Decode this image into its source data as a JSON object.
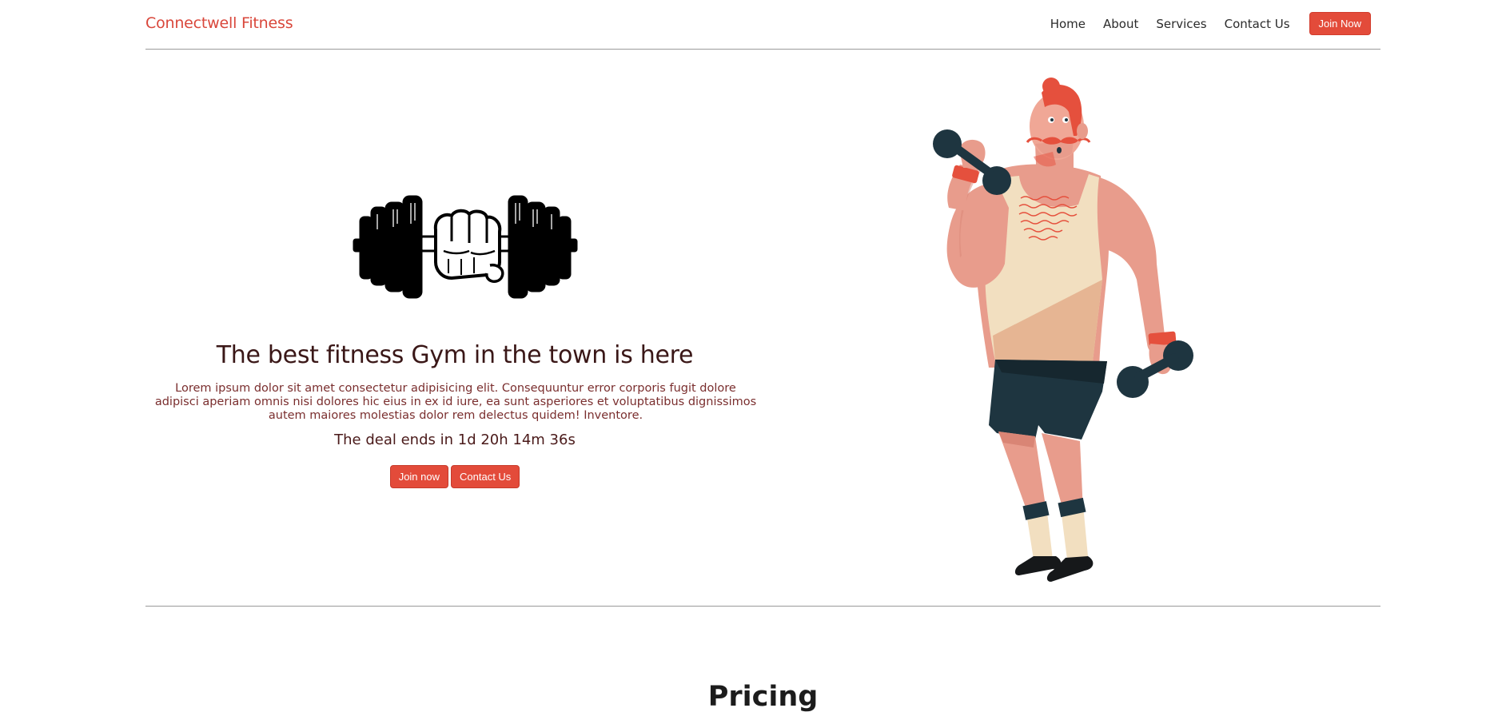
{
  "navbar": {
    "brand": "Connectwell Fitness",
    "links": [
      "Home",
      "About",
      "Services",
      "Contact Us"
    ],
    "cta_label": "Join Now"
  },
  "hero": {
    "title": "The best fitness Gym in the town is here",
    "text": "Lorem ipsum dolor sit amet consectetur adipisicing elit. Consequuntur error corporis fugit dolore adipisci aperiam omnis nisi dolores hic eius in ex id iure, ea sunt asperiores et voluptatibus dignissimos autem maiores molestias dolor rem delectus quidem! Inventore.",
    "deal": "The deal ends in 1d 20h 14m 36s",
    "primary_button": "Join now",
    "secondary_button": "Contact Us"
  },
  "pricing": {
    "title": "Pricing"
  },
  "colors": {
    "accent": "#e34b3a",
    "brand": "#d9473b",
    "divider": "#9a9a9a"
  },
  "icons": {
    "left_illustration": "dumbbell-fist-icon",
    "right_illustration": "bodybuilder-illustration"
  }
}
